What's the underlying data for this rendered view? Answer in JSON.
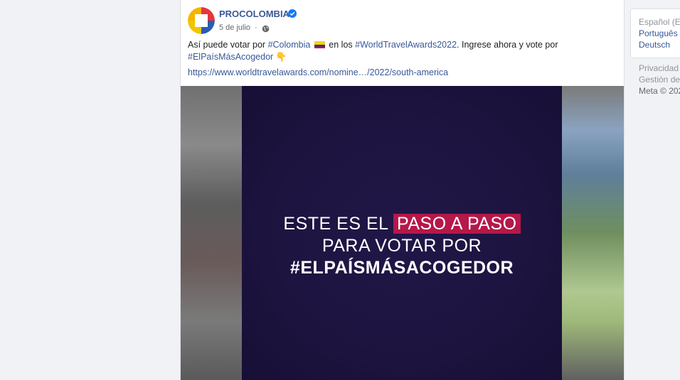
{
  "post": {
    "page_name": "PROCOLOMBIA",
    "date": "5 de julio",
    "separator": "·",
    "text_part1": "Así puede votar por ",
    "hashtag_colombia": "#Colombia",
    "text_part2": " en los ",
    "hashtag_wta": "#WorldTravelAwards2022",
    "text_part3": ". Ingrese ahora y vote por",
    "hashtag_pais": "#ElPaísMásAcogedor",
    "pointing_emoji": "👇",
    "link": "https://www.worldtravelawards.com/nomine…/2022/south-america",
    "icons": {
      "verified": "verified-badge-icon",
      "audience": "globe-icon",
      "flag": "colombia-flag-icon"
    }
  },
  "video": {
    "line1_prefix": "ESTE ES EL ",
    "line1_highlight": "PASO A PASO",
    "line2": "PARA VOTAR POR",
    "line3": "#ELPAÍSMÁSACOGEDOR"
  },
  "sidebar": {
    "lang_current": "Español (Es",
    "lang_portugues": "Português",
    "lang_deutsch": "Deutsch",
    "privacy": "Privacidad",
    "gestion": "Gestión de",
    "meta": "Meta © 202"
  },
  "colors": {
    "link": "#385898",
    "video_bg": "#1d1440",
    "highlight": "#b5184a"
  }
}
